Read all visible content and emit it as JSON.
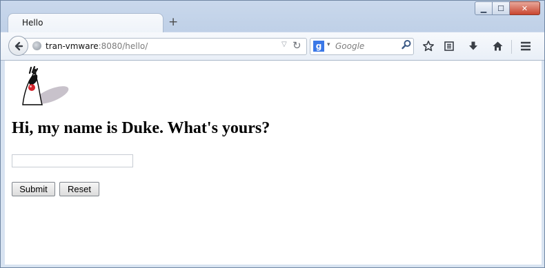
{
  "browser": {
    "tab_title": "Hello",
    "new_tab": "+",
    "url_host": "tran-vmware",
    "url_rest": ":8080/hello/",
    "search_engine_letter": "g",
    "search_placeholder": "Google",
    "window_controls": {
      "minimize": "▁",
      "maximize": "☐",
      "close": "✕"
    }
  },
  "icons": [
    "back-arrow-icon",
    "globe-icon",
    "reload-icon",
    "google-icon",
    "search-icon",
    "bookmark-star-icon",
    "reading-list-icon",
    "download-icon",
    "home-icon",
    "menu-icon",
    "duke-mascot-icon"
  ],
  "page": {
    "heading": "Hi, my name is Duke. What's yours?",
    "name_value": "",
    "submit_label": "Submit",
    "reset_label": "Reset"
  },
  "colors": {
    "accent": "#3b78e7",
    "close_button": "#c9452f"
  }
}
